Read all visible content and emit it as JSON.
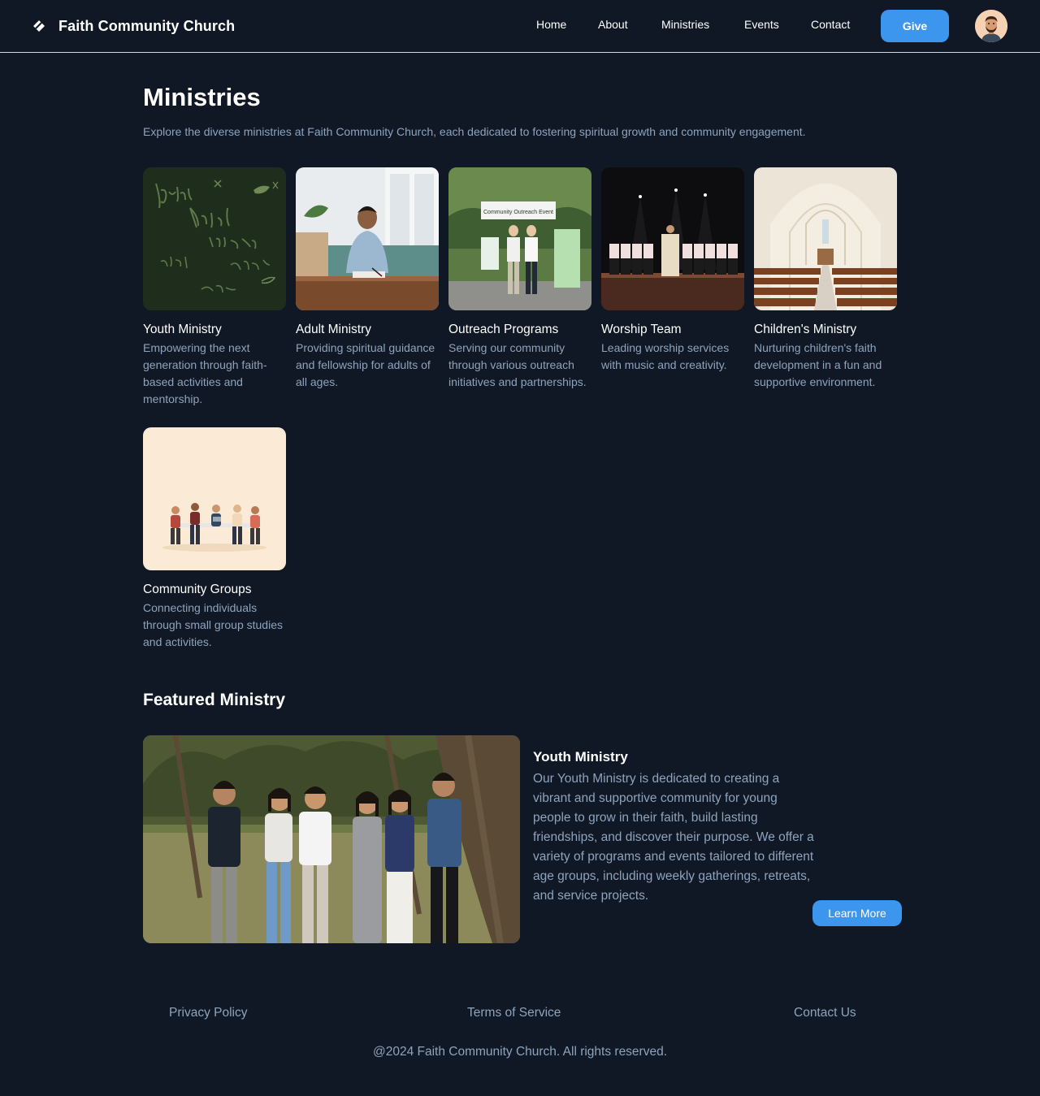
{
  "header": {
    "brand_name": "Faith Community Church",
    "brand_icon": "church-logo-icon",
    "nav": [
      {
        "label": "Home"
      },
      {
        "label": "About"
      },
      {
        "label": "Ministries"
      },
      {
        "label": "Events"
      },
      {
        "label": "Contact"
      }
    ],
    "give_label": "Give",
    "avatar_icon": "user-avatar"
  },
  "page": {
    "title": "Ministries",
    "intro": "Explore the diverse ministries at Faith Community Church, each dedicated to fostering spiritual growth and community engagement."
  },
  "ministries": [
    {
      "title": "Youth Ministry",
      "description": "Empowering the next generation through faith-based activities and mentorship.",
      "image": "chalkboard-youth-image"
    },
    {
      "title": "Adult Ministry",
      "description": "Providing spiritual guidance and fellowship for adults of all ages.",
      "image": "man-studying-image"
    },
    {
      "title": "Outreach Programs",
      "description": "Serving our community through various outreach initiatives and partnerships.",
      "image": "outreach-event-image",
      "sign_text": "Community Outreach Event"
    },
    {
      "title": "Worship Team",
      "description": "Leading worship services with music and creativity.",
      "image": "choir-stage-image"
    },
    {
      "title": "Children's Ministry",
      "description": "Nurturing children's faith development in a fun and supportive environment.",
      "image": "church-interior-image"
    },
    {
      "title": "Community Groups",
      "description": "Connecting individuals through small group studies and activities.",
      "image": "small-group-illustration"
    }
  ],
  "featured": {
    "section_title": "Featured Ministry",
    "name": "Youth Ministry",
    "description": "Our Youth Ministry is dedicated to creating a vibrant and supportive community for young people to grow in their faith, build lasting friendships, and discover their purpose. We offer a variety of programs and events tailored to different age groups, including weekly gatherings, retreats, and service projects.",
    "button_label": "Learn More",
    "image": "youth-group-photo"
  },
  "footer": {
    "links": [
      {
        "label": "Privacy Policy"
      },
      {
        "label": "Terms of Service"
      },
      {
        "label": "Contact Us"
      }
    ],
    "copyright": "@2024 Faith Community Church. All rights reserved."
  },
  "colors": {
    "background": "#0f1824",
    "accent": "#3d96ee",
    "muted_text": "#8fa3bd"
  }
}
